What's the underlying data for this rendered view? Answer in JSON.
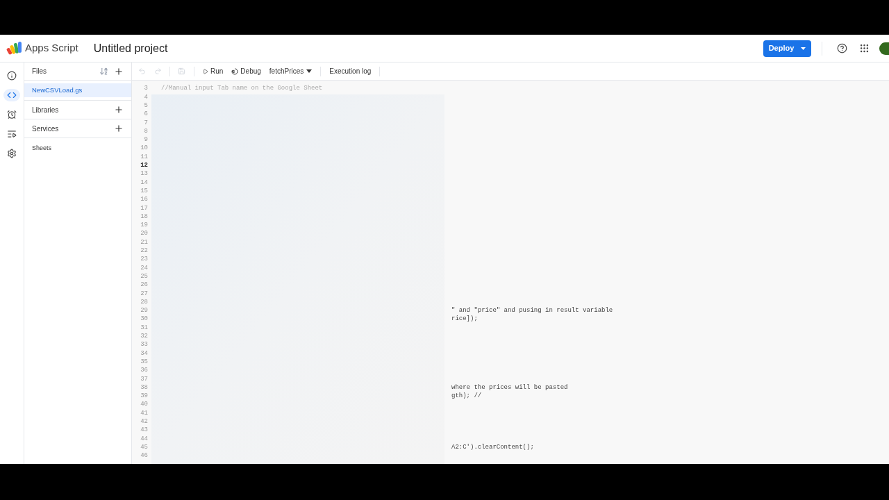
{
  "header": {
    "app_name": "Apps Script",
    "project_title": "Untitled project",
    "deploy_button": "Deploy"
  },
  "rail": [
    {
      "kind": "info",
      "selected": false
    },
    {
      "kind": "code",
      "selected": true
    },
    {
      "kind": "triggers",
      "selected": false
    },
    {
      "kind": "executions",
      "selected": false
    },
    {
      "kind": "settings",
      "selected": false
    }
  ],
  "files_panel": {
    "title": "Files",
    "files": [
      {
        "name": "NewCSVLoad.gs",
        "selected": true
      }
    ],
    "sections": [
      {
        "label": "Libraries"
      },
      {
        "label": "Services"
      }
    ],
    "services": [
      "Sheets"
    ]
  },
  "toolbar": {
    "run": "Run",
    "debug": "Debug",
    "function": "fetchPrices",
    "log": "Execution log"
  },
  "code_lines": [
    {
      "number": "3",
      "text": "//Manual input Tab name on the Google Sheet",
      "kind": "comment",
      "current": false
    },
    {
      "number": "4",
      "current": false
    },
    {
      "number": "5",
      "current": false
    },
    {
      "number": "6",
      "current": false
    },
    {
      "number": "7",
      "current": false
    },
    {
      "number": "8",
      "current": false
    },
    {
      "number": "9",
      "current": false
    },
    {
      "number": "10",
      "current": false
    },
    {
      "number": "11",
      "current": false
    },
    {
      "number": "12",
      "current": true
    },
    {
      "number": "13",
      "current": false
    },
    {
      "number": "14",
      "current": false
    },
    {
      "number": "15",
      "current": false
    },
    {
      "number": "16",
      "current": false
    },
    {
      "number": "17",
      "current": false
    },
    {
      "number": "18",
      "current": false
    },
    {
      "number": "19",
      "current": false
    },
    {
      "number": "20",
      "current": false
    },
    {
      "number": "21",
      "current": false
    },
    {
      "number": "22",
      "current": false
    },
    {
      "number": "23",
      "current": false
    },
    {
      "number": "24",
      "current": false
    },
    {
      "number": "25",
      "current": false
    },
    {
      "number": "26",
      "current": false
    },
    {
      "number": "27",
      "current": false
    },
    {
      "number": "28",
      "current": false
    },
    {
      "number": "29",
      "text": "\" and \"price\" and pusing in result variable",
      "kind": "fragment",
      "current": false
    },
    {
      "number": "30",
      "text": "rice]);",
      "kind": "fragment",
      "current": false
    },
    {
      "number": "31",
      "current": false
    },
    {
      "number": "32",
      "current": false
    },
    {
      "number": "33",
      "current": false
    },
    {
      "number": "34",
      "current": false
    },
    {
      "number": "35",
      "current": false
    },
    {
      "number": "36",
      "current": false
    },
    {
      "number": "37",
      "current": false
    },
    {
      "number": "38",
      "text": "where the prices will be pasted",
      "kind": "fragment",
      "current": false
    },
    {
      "number": "39",
      "text": "gth); //",
      "kind": "fragment",
      "current": false
    },
    {
      "number": "40",
      "current": false
    },
    {
      "number": "41",
      "current": false
    },
    {
      "number": "42",
      "current": false
    },
    {
      "number": "43",
      "current": false
    },
    {
      "number": "44",
      "current": false
    },
    {
      "number": "45",
      "text": "A2:C').clearContent();",
      "kind": "fragment",
      "current": false
    },
    {
      "number": "46",
      "current": false
    }
  ]
}
